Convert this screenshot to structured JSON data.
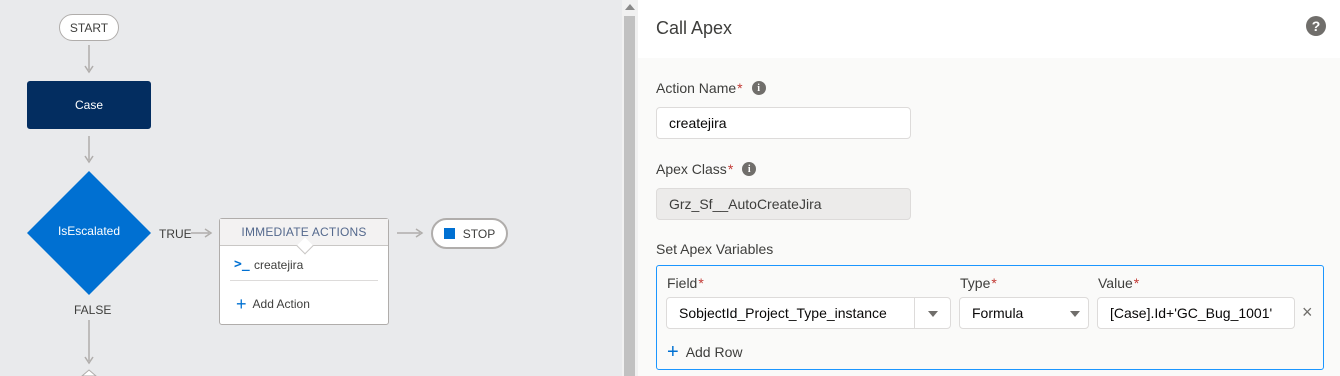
{
  "canvas": {
    "start_label": "START",
    "case_label": "Case",
    "decision_label": "IsEscalated",
    "true_label": "TRUE",
    "false_label": "FALSE",
    "immediate_actions": {
      "header": "IMMEDIATE ACTIONS",
      "action_icon": "apex-icon",
      "action_label": "createjira",
      "add_action_label": "Add Action"
    },
    "stop_label": "STOP",
    "colors": {
      "case_node": "#032d60",
      "decision_node": "#0070d2",
      "accent": "#0070d2"
    }
  },
  "panel": {
    "title": "Call Apex",
    "help_icon": "?",
    "action_name": {
      "label": "Action Name",
      "required": "*",
      "value": "createjira"
    },
    "apex_class": {
      "label": "Apex Class",
      "required": "*",
      "value": "Grz_Sf__AutoCreateJira"
    },
    "apex_variables": {
      "label": "Set Apex Variables",
      "columns": {
        "field": "Field",
        "type": "Type",
        "value": "Value"
      },
      "required": "*",
      "row": {
        "field": "SobjectId_Project_Type_instance",
        "type": "Formula",
        "value": "[Case].Id+'GC_Bug_1001'"
      },
      "remove_icon": "×",
      "add_row_label": "Add Row"
    }
  }
}
